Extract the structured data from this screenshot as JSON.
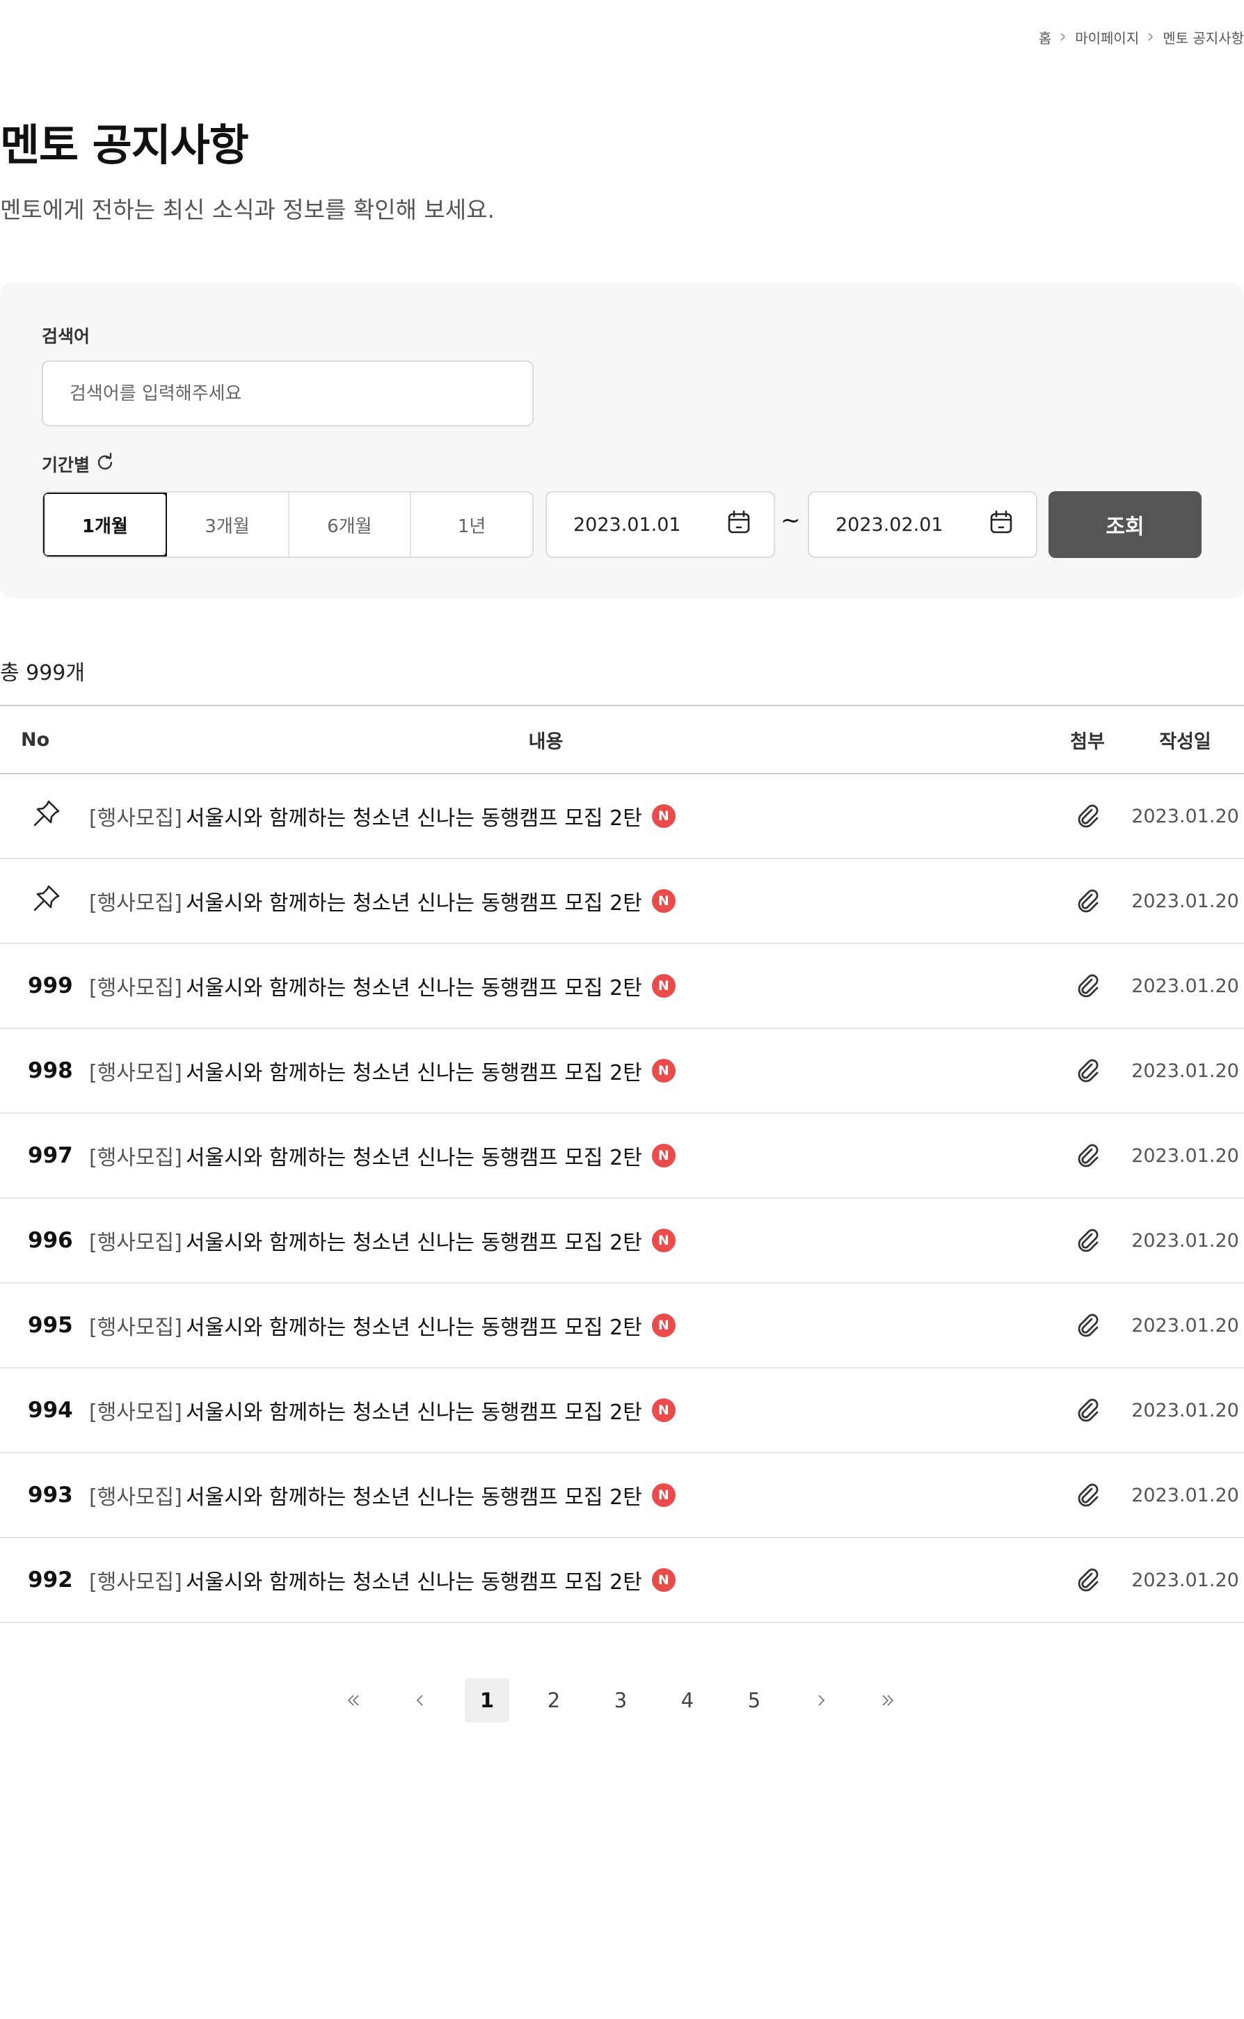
{
  "breadcrumb": [
    "홈",
    "마이페이지",
    "멘토 공지사항"
  ],
  "page": {
    "title": "멘토 공지사항",
    "subtitle": "멘토에게 전하는 최신 소식과 정보를 확인해 보세요."
  },
  "search": {
    "keyword_label": "검색어",
    "keyword_placeholder": "검색어를 입력해주세요",
    "period_label": "기간별",
    "periods": [
      "1개월",
      "3개월",
      "6개월",
      "1년"
    ],
    "active_period": "1개월",
    "start_date": "2023.01.01",
    "end_date": "2023.02.01",
    "tilde": "~",
    "submit_label": "조회"
  },
  "total_text": "총 999개",
  "table": {
    "headers": {
      "no": "No",
      "title": "내용",
      "attach": "첨부",
      "date": "작성일"
    },
    "rows": [
      {
        "no": "",
        "pinned": true,
        "category": "[행사모집]",
        "title": "서울시와 함께하는 청소년 신나는 동행캠프 모집 2탄",
        "badge": "N",
        "date": "2023.01.20"
      },
      {
        "no": "",
        "pinned": true,
        "category": "[행사모집]",
        "title": "서울시와 함께하는 청소년 신나는 동행캠프 모집 2탄",
        "badge": "N",
        "date": "2023.01.20"
      },
      {
        "no": "999",
        "pinned": false,
        "category": "[행사모집]",
        "title": "서울시와 함께하는 청소년 신나는 동행캠프 모집 2탄",
        "badge": "N",
        "date": "2023.01.20"
      },
      {
        "no": "998",
        "pinned": false,
        "category": "[행사모집]",
        "title": "서울시와 함께하는 청소년 신나는 동행캠프 모집 2탄",
        "badge": "N",
        "date": "2023.01.20"
      },
      {
        "no": "997",
        "pinned": false,
        "category": "[행사모집]",
        "title": "서울시와 함께하는 청소년 신나는 동행캠프 모집 2탄",
        "badge": "N",
        "date": "2023.01.20"
      },
      {
        "no": "996",
        "pinned": false,
        "category": "[행사모집]",
        "title": "서울시와 함께하는 청소년 신나는 동행캠프 모집 2탄",
        "badge": "N",
        "date": "2023.01.20"
      },
      {
        "no": "995",
        "pinned": false,
        "category": "[행사모집]",
        "title": "서울시와 함께하는 청소년 신나는 동행캠프 모집 2탄",
        "badge": "N",
        "date": "2023.01.20"
      },
      {
        "no": "994",
        "pinned": false,
        "category": "[행사모집]",
        "title": "서울시와 함께하는 청소년 신나는 동행캠프 모집 2탄",
        "badge": "N",
        "date": "2023.01.20"
      },
      {
        "no": "993",
        "pinned": false,
        "category": "[행사모집]",
        "title": "서울시와 함께하는 청소년 신나는 동행캠프 모집 2탄",
        "badge": "N",
        "date": "2023.01.20"
      },
      {
        "no": "992",
        "pinned": false,
        "category": "[행사모집]",
        "title": "서울시와 함께하는 청소년 신나는 동행캠프 모집 2탄",
        "badge": "N",
        "date": "2023.01.20"
      }
    ]
  },
  "pagination": {
    "pages": [
      "1",
      "2",
      "3",
      "4",
      "5"
    ],
    "current": "1"
  },
  "colors": {
    "accent_button": "#555555",
    "new_badge": "#ea4b4b",
    "panel_bg": "#f7f7f7"
  },
  "icons": {
    "breadcrumb_separator": "chevron-right-icon",
    "refresh": "refresh-icon",
    "calendar": "calendar-icon",
    "pin": "pin-icon",
    "attachment": "paperclip-icon",
    "first_page": "double-chevron-left-icon",
    "prev_page": "chevron-left-icon",
    "next_page": "chevron-right-icon",
    "last_page": "double-chevron-right-icon"
  }
}
